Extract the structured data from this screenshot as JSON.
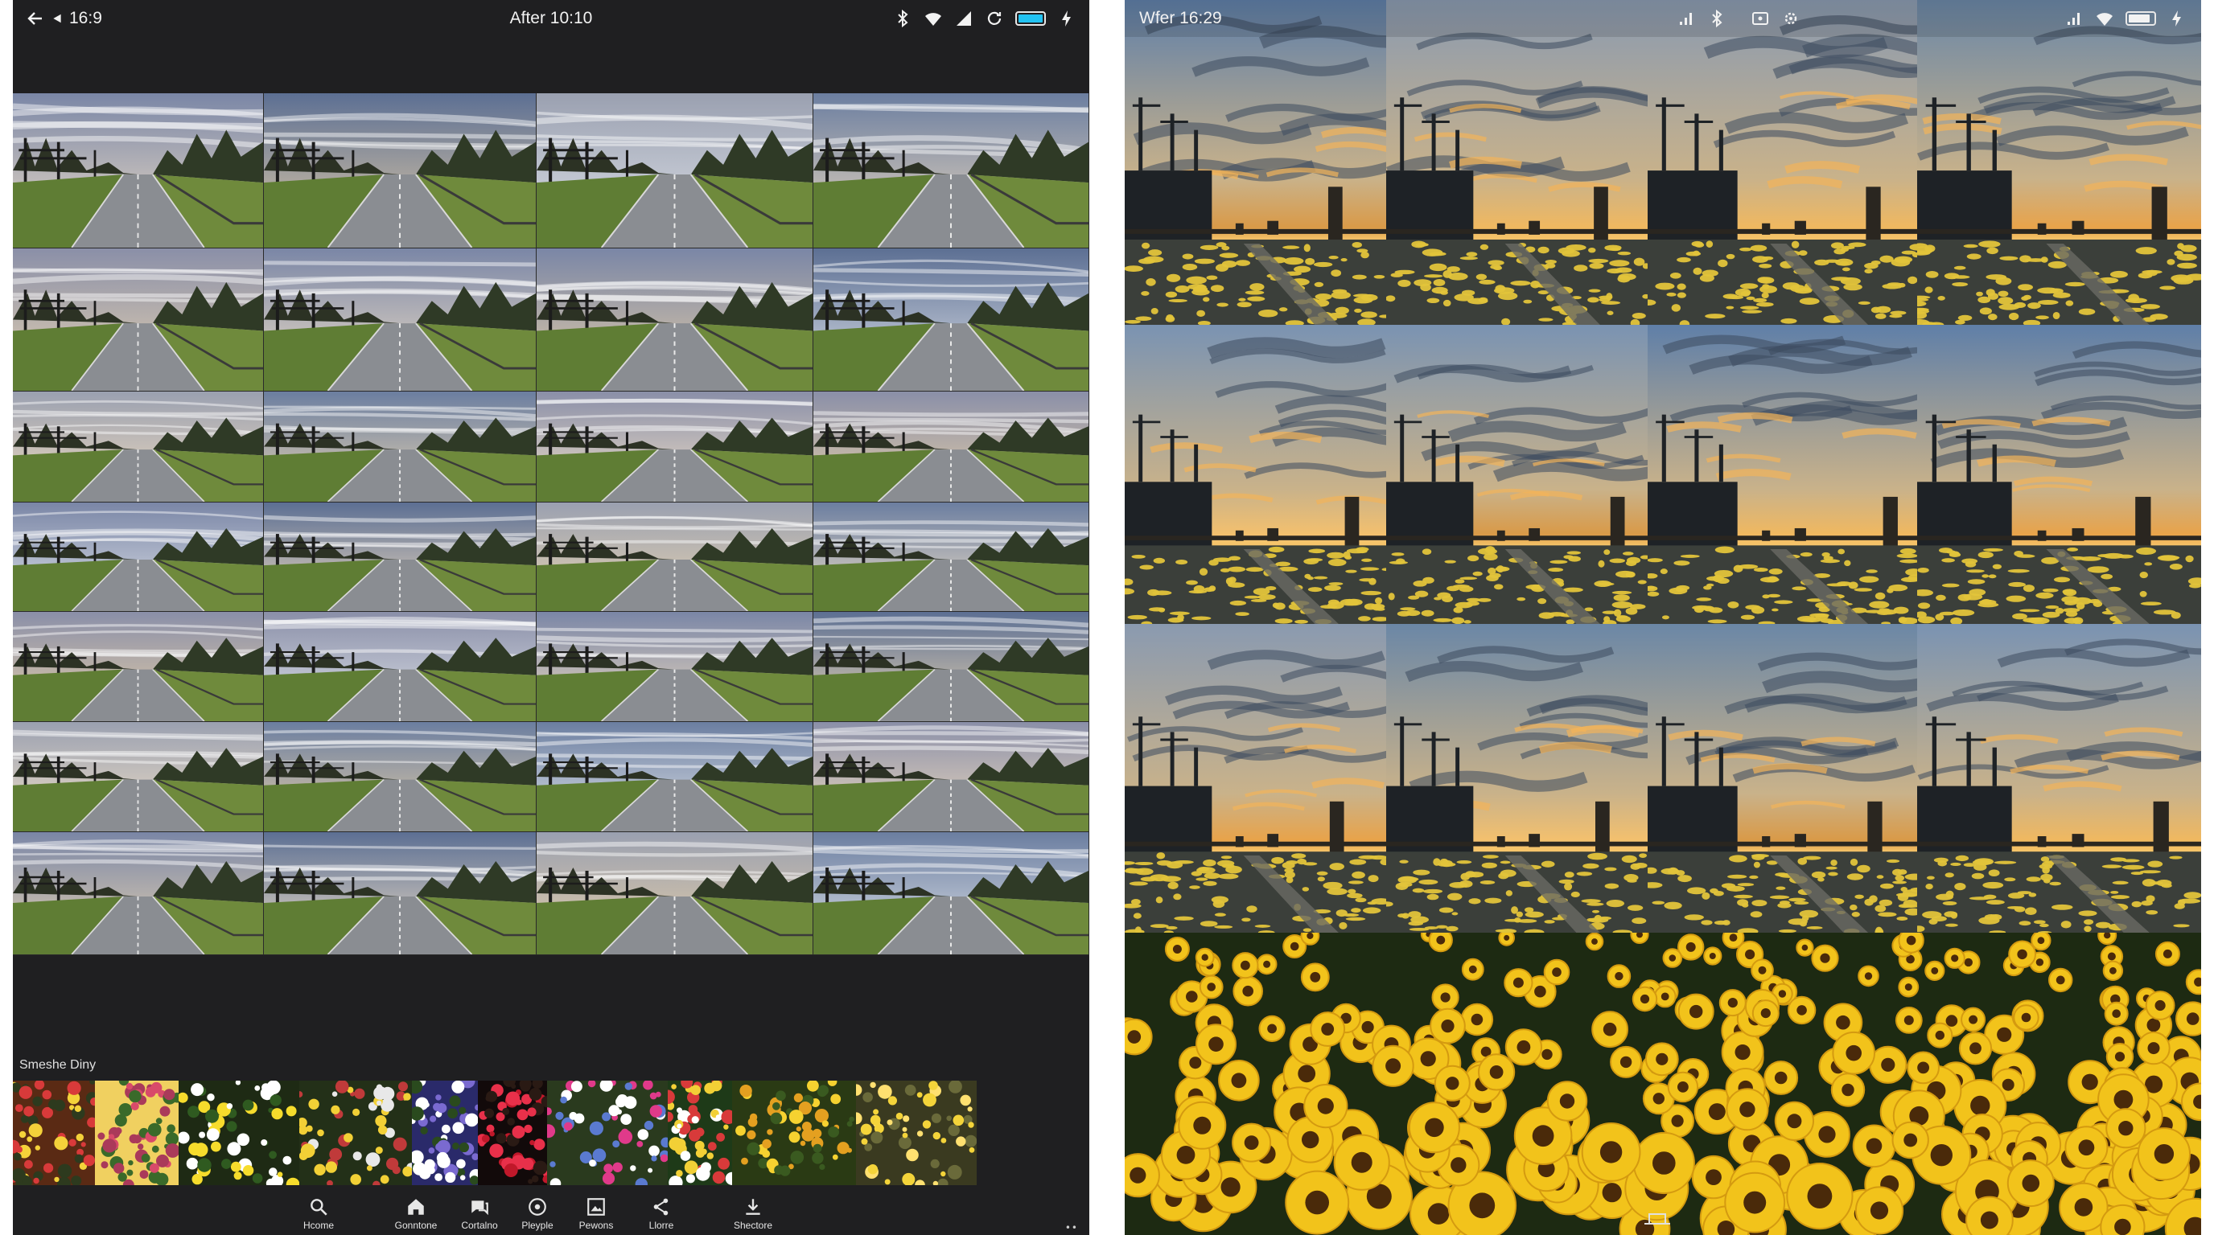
{
  "left_screen": {
    "status_bar": {
      "time": "16:9",
      "title": "After 10:10",
      "icons": [
        "back-arrow-icon",
        "location-arrow-icon",
        "bluetooth-icon",
        "wifi-icon",
        "signal-icon",
        "refresh-icon",
        "battery-icon",
        "charging-icon"
      ],
      "battery_color": "#22c3f2"
    },
    "photo_grid": {
      "rows": 7,
      "columns": 4,
      "subject": "road-through-park"
    },
    "strip": {
      "label": "Smeshe Diny",
      "thumbnails": 7
    },
    "nav": {
      "items": [
        {
          "label": "Hcome",
          "icon": "search-icon"
        },
        {
          "label": "Gonntone",
          "icon": "home-icon"
        },
        {
          "label": "Cortalno",
          "icon": "chat-icon"
        },
        {
          "label": "Pleyple",
          "icon": "circle-dot-icon"
        },
        {
          "label": "Pewons",
          "icon": "image-icon"
        },
        {
          "label": "Llorre",
          "icon": "share-icon"
        },
        {
          "label": "Shectore",
          "icon": "download-icon"
        }
      ],
      "more": "••"
    }
  },
  "right_screen": {
    "status_bar": {
      "time": "Wfer 16:29",
      "icons": [
        "signal-icon",
        "bluetooth-icon",
        "cast-icon",
        "settings-icon",
        "signal-icon",
        "wifi-icon",
        "battery-icon",
        "charging-icon"
      ]
    },
    "photo_grid": {
      "rows": 3,
      "columns": 4,
      "subject": "sunset-yellow-flower-field"
    },
    "flower_panel": {
      "subject": "sunflower-field"
    }
  },
  "colors": {
    "left_bg": "#1f1f21",
    "right_bg": "#0e0e0e",
    "sunflower": "#f2c31b",
    "sky_blue": "#6f8fb3",
    "sunset_orange": "#f0a53a"
  }
}
